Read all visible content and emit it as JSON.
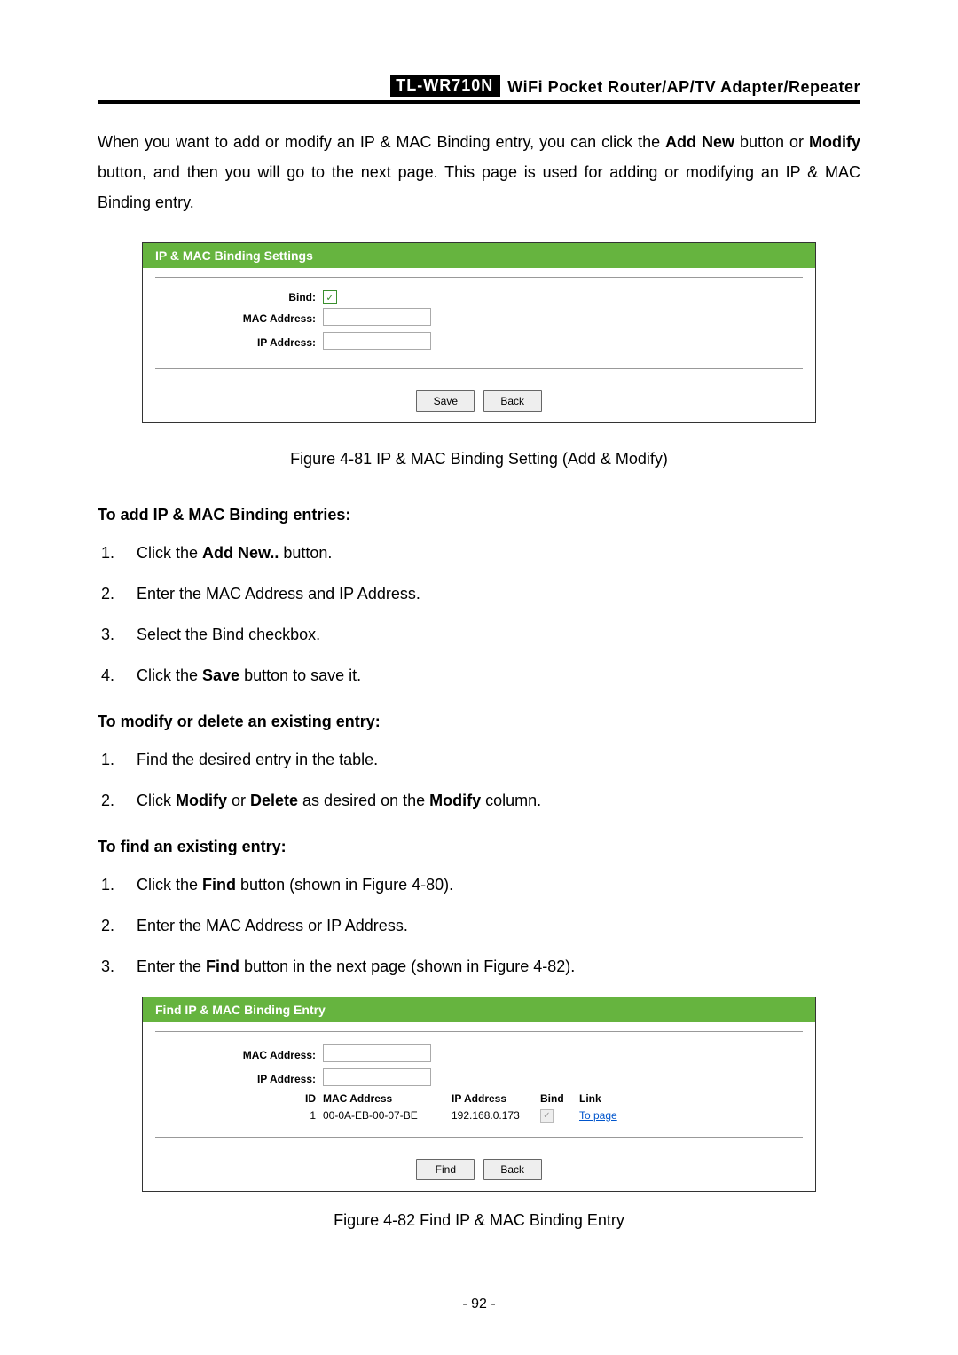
{
  "header": {
    "model": "TL-WR710N",
    "desc": "WiFi  Pocket  Router/AP/TV  Adapter/Repeater"
  },
  "intro": {
    "pre": "When you want to add or modify an IP & MAC Binding entry, you can click the ",
    "b1": "Add New",
    "mid1": " button or ",
    "b2": "Modify",
    "mid2": " button, and then you will go to the next page. This page is used for adding or modifying an IP & MAC Binding entry."
  },
  "panel1": {
    "title": "IP & MAC Binding Settings",
    "labels": {
      "bind": "Bind:",
      "mac": "MAC Address:",
      "ip": "IP Address:"
    },
    "check": "✓",
    "buttons": {
      "save": "Save",
      "back": "Back"
    }
  },
  "caption1": "Figure 4-81 IP & MAC Binding Setting (Add & Modify)",
  "sections": {
    "add_title": "To add IP & MAC Binding entries:",
    "add_steps": {
      "s1_pre": "Click the ",
      "s1_b": "Add New..",
      "s1_post": " button.",
      "s2": "Enter the MAC Address and IP Address.",
      "s3": "Select the Bind checkbox.",
      "s4_pre": "Click the ",
      "s4_b": "Save",
      "s4_post": " button to save it."
    },
    "mod_title": "To modify or delete an existing entry:",
    "mod_steps": {
      "s1": "Find the desired entry in the table.",
      "s2_pre": "Click ",
      "s2_b1": "Modify",
      "s2_mid": " or ",
      "s2_b2": "Delete",
      "s2_mid2": " as desired on the ",
      "s2_b3": "Modify",
      "s2_post": " column."
    },
    "find_title": "To find an existing entry:",
    "find_steps": {
      "s1_pre": "Click the ",
      "s1_b": "Find",
      "s1_post": " button (shown in Figure 4-80).",
      "s2": "Enter the MAC Address or IP Address.",
      "s3_pre": "Enter the ",
      "s3_b": "Find",
      "s3_post": " button in the next page (shown in Figure 4-82)."
    }
  },
  "panel2": {
    "title": "Find IP & MAC Binding Entry",
    "labels": {
      "mac": "MAC Address:",
      "ip": "IP Address:"
    },
    "cols": {
      "id": "ID",
      "mac": "MAC Address",
      "ip": "IP Address",
      "bind": "Bind",
      "link": "Link"
    },
    "row": {
      "id": "1",
      "mac": "00-0A-EB-00-07-BE",
      "ip": "192.168.0.173",
      "check": "✓",
      "link": "To page"
    },
    "buttons": {
      "find": "Find",
      "back": "Back"
    }
  },
  "caption2": "Figure 4-82 Find IP & MAC Binding Entry",
  "page_num": "- 92 -"
}
